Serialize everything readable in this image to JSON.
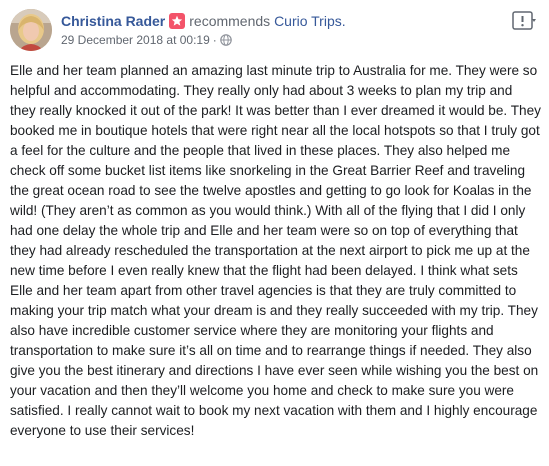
{
  "post": {
    "author": "Christina Rader",
    "action": "recommends",
    "page": "Curio Trips.",
    "timestamp": "29 December 2018 at 00:19",
    "separator": "·",
    "privacy_icon": "globe-icon",
    "badge_icon": "star-icon",
    "more_icon": "more-options-icon",
    "review_text": "Elle and her team planned an amazing last minute trip to Australia for me. They were so helpful and accommodating. They really only had about 3 weeks to plan my trip and they really knocked it out of the park! It was better than I ever dreamed it would be. They booked me in boutique hotels that were right near all the local hotspots so that I truly got a feel for the culture and the people that lived in these places. They also helped me check off some bucket list items like snorkeling in the Great Barrier Reef and traveling the great ocean road to see the twelve apostles and getting to go look for Koalas in the wild! (They aren’t as common as you would think.) With all of the flying that I did I only had one delay the whole trip and Elle and her team were so on top of everything that they had already rescheduled the transportation at the next airport to pick me up at the new time before I even really knew that the flight had been delayed. I think what sets Elle and her team apart from other travel agencies is that they are truly committed to making your trip match what your dream is and they really succeeded with my trip. They also have incredible customer service where they are monitoring your flights and transportation to make sure it’s all on time and to rearrange things if needed. They also give you the best itinerary and directions I have ever seen while wishing you the best on your vacation and then they’ll welcome you home and check to make sure you were satisfied. I really cannot wait to book my next vacation with them and I highly encourage everyone to use their services!"
  },
  "colors": {
    "link": "#365899",
    "secondary_text": "#616770",
    "badge": "#f35369",
    "body_text": "#1c1e21"
  }
}
